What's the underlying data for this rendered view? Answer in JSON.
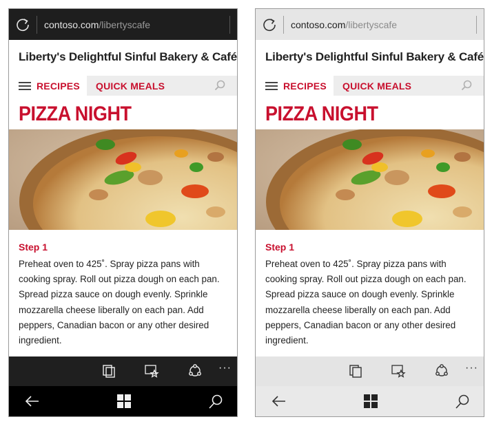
{
  "phones": [
    {
      "theme": "dark",
      "address_bar": {
        "url_host": "contoso.com",
        "url_path": "/libertyscafe"
      },
      "site_title": "Liberty's Delightful Sinful Bakery & Café",
      "nav": {
        "tab1": "RECIPES",
        "tab2": "QUICK MEALS"
      },
      "headline": "PIZZA NIGHT",
      "step_title": "Step 1",
      "step_body": "Preheat oven to 425˚. Spray pizza pans with cooking spray. Roll out pizza dough on each pan. Spread pizza sauce on dough evenly. Sprinkle mozzarella cheese liberally on each pan. Add peppers, Canadian bacon or any other desired ingredient.",
      "appbar_more": "···"
    },
    {
      "theme": "light",
      "address_bar": {
        "url_host": "contoso.com",
        "url_path": "/libertyscafe"
      },
      "site_title": "Liberty's Delightful Sinful Bakery & Café",
      "nav": {
        "tab1": "RECIPES",
        "tab2": "QUICK MEALS"
      },
      "headline": "PIZZA NIGHT",
      "step_title": "Step 1",
      "step_body": "Preheat oven to 425˚. Spray pizza pans with cooking spray. Roll out pizza dough on each pan. Spread pizza sauce on dough evenly. Sprinkle mozzarella cheese liberally on each pan. Add peppers, Canadian bacon or any other desired ingredient.",
      "appbar_more": "···"
    }
  ],
  "colors": {
    "accent": "#c8102e",
    "dark_chrome": "#1e1e1e",
    "light_chrome": "#e6e6e6"
  },
  "icons": [
    "refresh-icon",
    "hamburger-icon",
    "search-icon",
    "tabs-icon",
    "favorites-icon",
    "share-icon",
    "more-icon",
    "back-icon",
    "windows-icon",
    "cortana-search-icon"
  ]
}
